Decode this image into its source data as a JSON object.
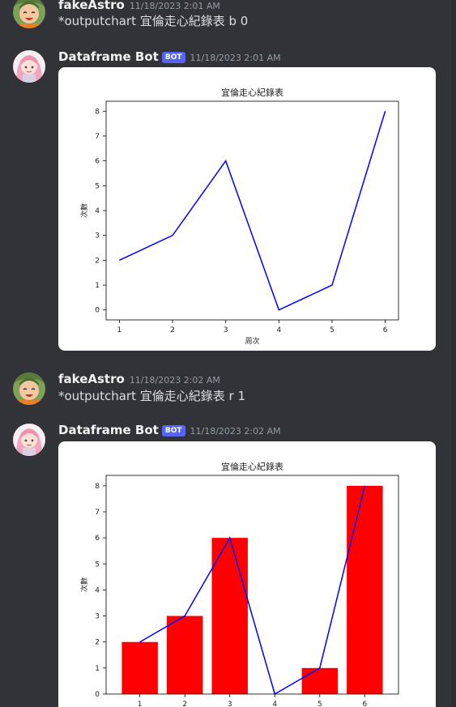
{
  "messages": [
    {
      "author": "fakeAstro",
      "time": "11/18/2023 2:01 AM",
      "content": "*outputchart 宜倫走心紀錄表 b 0"
    },
    {
      "author": "Dataframe Bot",
      "badge": "BOT",
      "time": "11/18/2023 2:01 AM"
    },
    {
      "author": "fakeAstro",
      "time": "11/18/2023 2:02 AM",
      "content": "*outputchart 宜倫走心紀錄表 r 1"
    },
    {
      "author": "Dataframe Bot",
      "badge": "BOT",
      "time": "11/18/2023 2:02 AM"
    }
  ],
  "chart_data": [
    {
      "type": "line",
      "title": "宜倫走心紀錄表",
      "xlabel": "周次",
      "ylabel": "次數",
      "x": [
        1,
        2,
        3,
        4,
        5,
        6
      ],
      "series": [
        {
          "values": [
            2,
            3,
            6,
            0,
            1,
            8
          ],
          "color": "#0000ff"
        }
      ],
      "xlim": [
        0.75,
        6.25
      ],
      "ylim": [
        -0.4,
        8.4
      ],
      "yticks": [
        0,
        1,
        2,
        3,
        4,
        5,
        6,
        7,
        8
      ],
      "grid": false
    },
    {
      "type": "bar",
      "title": "宜倫走心紀錄表",
      "xlabel": "",
      "ylabel": "次數",
      "x": [
        1,
        2,
        3,
        4,
        5,
        6
      ],
      "bar_values": [
        2,
        3,
        6,
        0,
        1,
        8
      ],
      "bar_color": "#ff0000",
      "series": [
        {
          "values": [
            2,
            3,
            6,
            0,
            1,
            8
          ],
          "color": "#0000ff"
        }
      ],
      "xlim": [
        0.25,
        6.75
      ],
      "ylim": [
        0,
        8.4
      ],
      "yticks": [
        0,
        1,
        2,
        3,
        4,
        5,
        6,
        7,
        8
      ],
      "grid": false
    }
  ]
}
